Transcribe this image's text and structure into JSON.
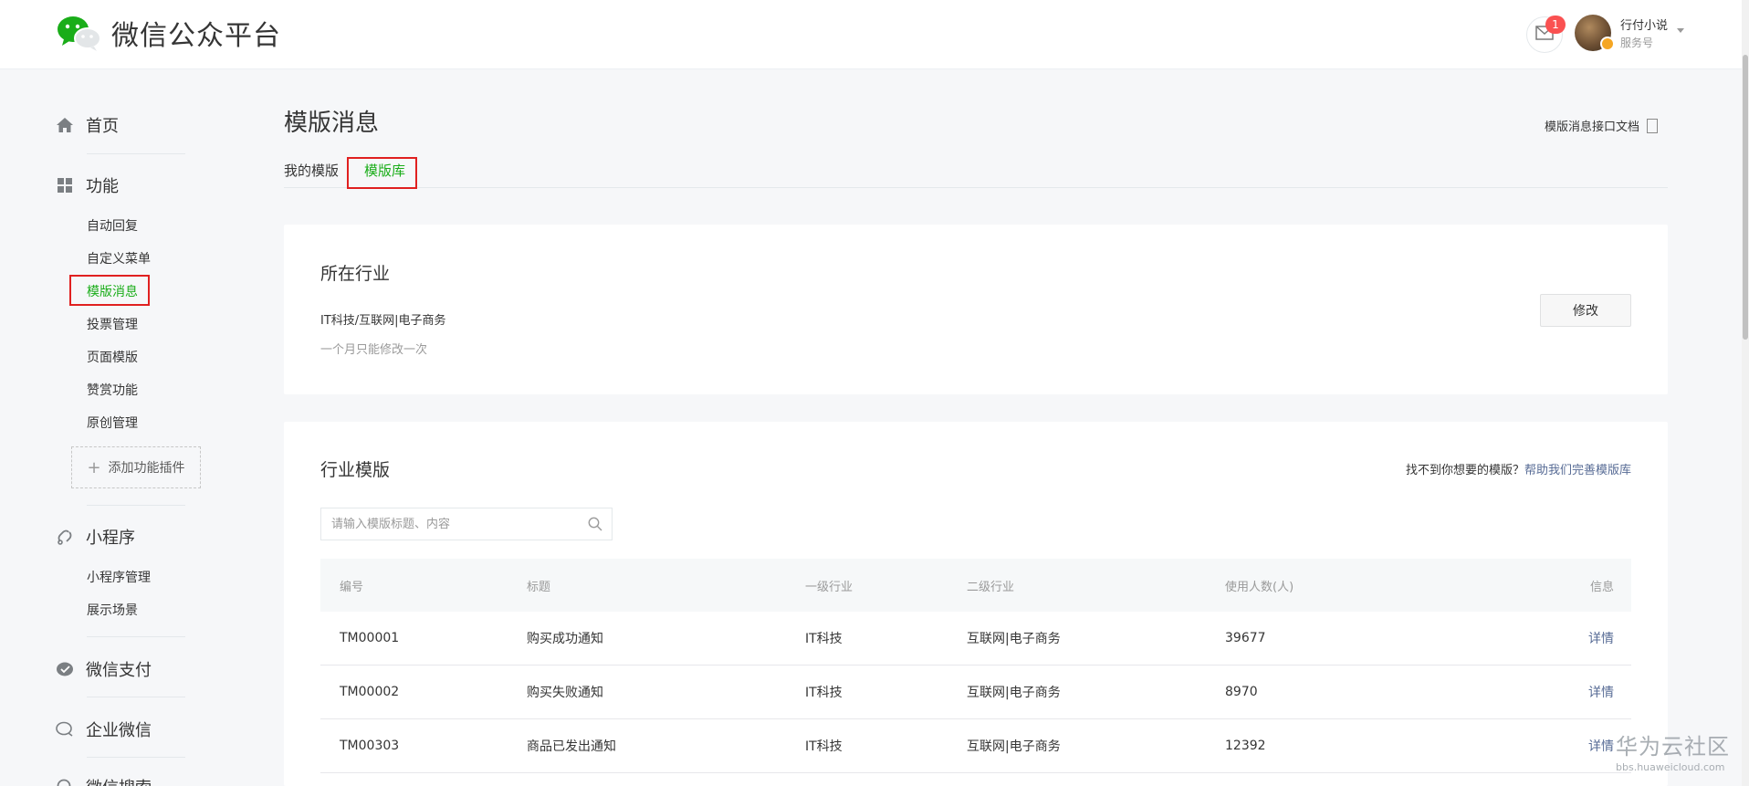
{
  "header": {
    "app_title": "微信公众平台",
    "message_badge": "1",
    "account_name": "行付小说",
    "account_type": "服务号"
  },
  "sidebar": {
    "home": "首页",
    "features": "功能",
    "feature_items": [
      "自动回复",
      "自定义菜单",
      "模版消息",
      "投票管理",
      "页面模版",
      "赞赏功能",
      "原创管理"
    ],
    "add_plugin": "添加功能插件",
    "mini_program": "小程序",
    "mini_program_items": [
      "小程序管理",
      "展示场景"
    ],
    "wechat_pay": "微信支付",
    "enterprise_wechat": "企业微信",
    "wechat_search": "微信搜索"
  },
  "main": {
    "title": "模版消息",
    "doc_link": "模版消息接口文档",
    "tabs": [
      "我的模版",
      "模版库"
    ],
    "industry": {
      "title": "所在行业",
      "value": "IT科技/互联网|电子商务",
      "tip": "一个月只能修改一次",
      "edit_button": "修改"
    },
    "templates": {
      "title": "行业模版",
      "help_prefix": "找不到你想要的模版？",
      "help_link": "帮助我们完善模版库",
      "search_placeholder": "请输入模版标题、内容",
      "columns": [
        "编号",
        "标题",
        "一级行业",
        "二级行业",
        "使用人数(人)",
        "信息"
      ],
      "rows": [
        {
          "id": "TM00001",
          "title": "购买成功通知",
          "primary": "IT科技",
          "secondary": "互联网|电子商务",
          "users": "39677",
          "info": "详情"
        },
        {
          "id": "TM00002",
          "title": "购买失败通知",
          "primary": "IT科技",
          "secondary": "互联网|电子商务",
          "users": "8970",
          "info": "详情"
        },
        {
          "id": "TM00303",
          "title": "商品已发出通知",
          "primary": "IT科技",
          "secondary": "互联网|电子商务",
          "users": "12392",
          "info": "详情"
        }
      ]
    }
  },
  "watermark": {
    "main": "华为云社区",
    "sub": "bbs.huaweicloud.com"
  },
  "colors": {
    "accent": "#1aad19",
    "link": "#576b95",
    "highlight_box": "#e02020",
    "badge": "#fa5151"
  }
}
